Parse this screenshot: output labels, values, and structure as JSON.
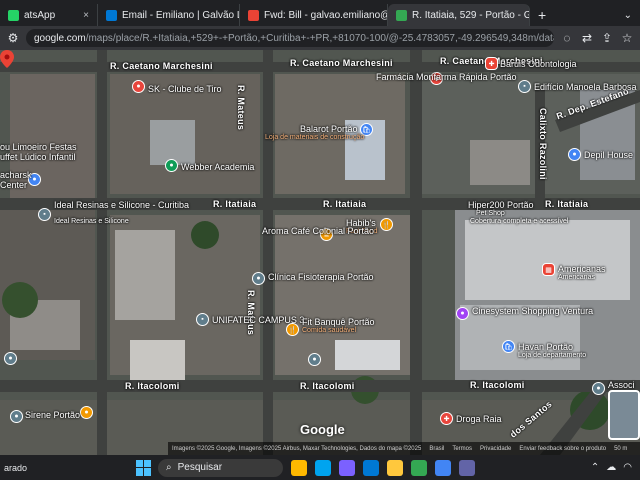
{
  "tabs": [
    {
      "label": "atsApp",
      "color": "#25d366",
      "active": false
    },
    {
      "label": "Email - Emiliano | Galvão Locaç",
      "color": "#0078d4",
      "active": false
    },
    {
      "label": "Fwd: Bill - galvao.emiliano@gm",
      "color": "#ea4335",
      "active": false
    },
    {
      "label": "R. Itatiaia, 529 - Portão - Googl",
      "color": "#34a853",
      "active": true
    }
  ],
  "new_tab_label": "+",
  "close_glyph": "×",
  "omnibox": {
    "host": "google.com",
    "path": "/maps/place/R.+Itatiaia,+529+-+Portão,+Curitiba+-+PR,+81070-100/@-25.4783057,-49.296549,348m/data=!3m1!1e3!4m..."
  },
  "map": {
    "streets": [
      {
        "name": "R. Caetano Marchesini"
      },
      {
        "name": "R. Caetano Marchesini"
      },
      {
        "name": "R. Caetano Marchesini"
      },
      {
        "name": "R. Itatiaia"
      },
      {
        "name": "R. Itatiaia"
      },
      {
        "name": "R. Itatiaia"
      },
      {
        "name": "R. Itacolomi"
      },
      {
        "name": "R. Itacolomi"
      },
      {
        "name": "R. Itacolomi"
      },
      {
        "name": "R. Mateus"
      },
      {
        "name": "R. Mateus"
      },
      {
        "name": "Calixto Razolini"
      },
      {
        "name": "R. Dep. Estefano"
      },
      {
        "name": "dos Santos"
      }
    ],
    "places": [
      {
        "name": "SK - Clube de Tiro"
      },
      {
        "name": "Farmácia Monfarma Rápida Portão"
      },
      {
        "name": "Baruis Odontologia"
      },
      {
        "name": "Edifício Manoela Barbosa"
      },
      {
        "name": "Balarot Portão",
        "sub": "Loja de materiais de construção"
      },
      {
        "name": "Webber Academia"
      },
      {
        "name": "Depil House"
      },
      {
        "name": "ou Limoeiro Festas",
        "sub": "uffet Lúdico Infantil"
      },
      {
        "name": "acharsk",
        "sub": "Center"
      },
      {
        "name": "Ideal Resinas e Silicone - Curitiba",
        "sub": "Ideal Resinas e Silicone"
      },
      {
        "name": "Habib's",
        "sub": "Fast Food"
      },
      {
        "name": "Hiper200 Portão",
        "sub": "Pet Shop"
      },
      {
        "name": "Cobertura completa e acessível"
      },
      {
        "name": "Aroma Café Colonial Portão"
      },
      {
        "name": "Clínica Fisioterapia Portão"
      },
      {
        "name": "Americanas",
        "sub": "Americanas"
      },
      {
        "name": "Cinesystem Shopping Ventura"
      },
      {
        "name": "UNIFATEC CAMPUS 3"
      },
      {
        "name": "Fit Banquê Portão",
        "sub": "Comida saudável"
      },
      {
        "name": "Havan Portão",
        "sub": "Loja de departamento"
      },
      {
        "name": "Sirene Portão"
      },
      {
        "name": "Droga Raia"
      },
      {
        "name": "Associ"
      }
    ],
    "pin_address": "R. Itatiaia, 529",
    "logo": "Google",
    "attribution": "Imagens ©2025 Google, Imagens ©2025 Airbus, Maxar Technologies, Dados do mapa ©2025",
    "attr_links": [
      "Brasil",
      "Termos",
      "Privacidade",
      "Enviar feedback sobre o produto",
      "50 m"
    ]
  },
  "taskbar": {
    "weather": "arado",
    "search_placeholder": "Pesquisar",
    "apps": [
      "#ffb900",
      "#00a4ef",
      "#7b61ff",
      "#0078d4",
      "#ffc83d",
      "#34a853",
      "#4285f4",
      "#6264a7"
    ]
  },
  "colors": {
    "accent": "#4285f4",
    "chrome_dark": "#202124",
    "chrome_mid": "#35363a"
  }
}
